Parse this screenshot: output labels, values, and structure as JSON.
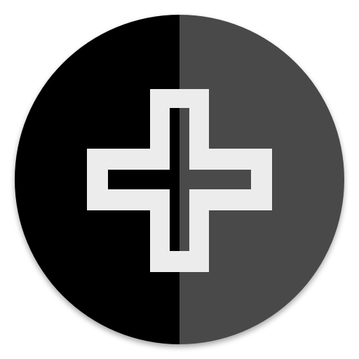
{
  "icon": {
    "name": "medical-cross-app-icon",
    "shape": "circle",
    "symbol": "plus-cross-outline"
  },
  "colors": {
    "background": "#ffffff",
    "left_half": "#000000",
    "right_half": "#4a4a4a",
    "cross_outline": "#ececec",
    "cross_inner_left": "#000000",
    "cross_inner_right": "#4a4a4a",
    "shadow": "#000000"
  }
}
